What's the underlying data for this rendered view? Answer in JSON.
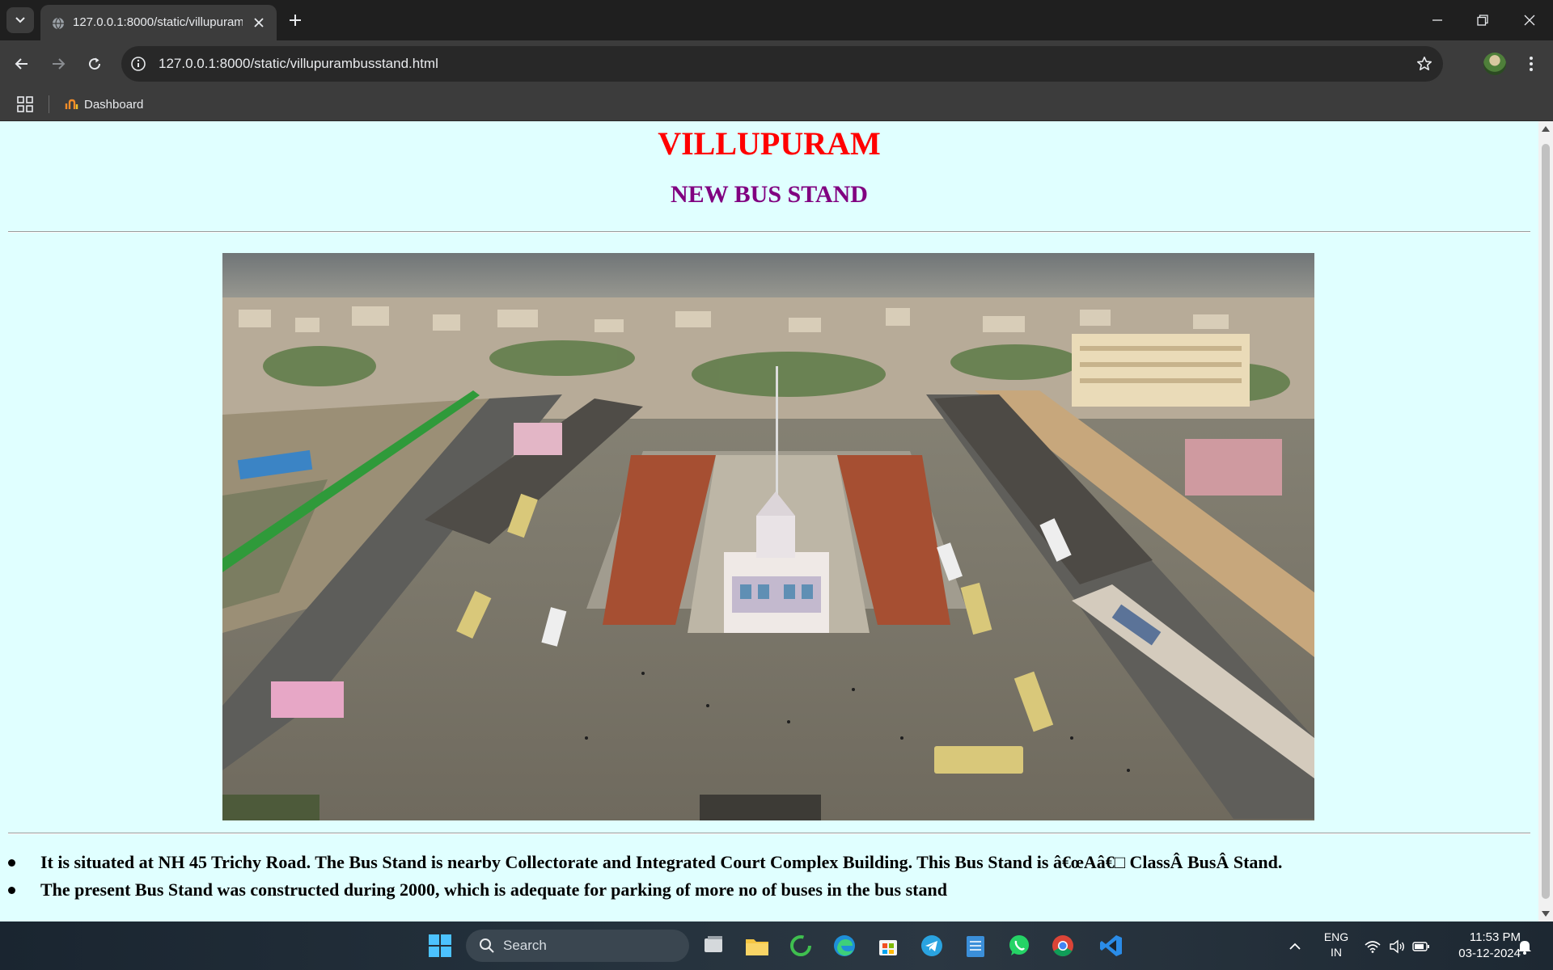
{
  "browser": {
    "tab_title": "127.0.0.1:8000/static/villupurambusstand.html",
    "url": "127.0.0.1:8000/static/villupurambusstand.html",
    "bookmark_label": "Dashboard"
  },
  "page": {
    "heading": "VILLUPURAM",
    "subheading": "NEW BUS STAND",
    "bullets": [
      "It is situated at NH 45 Trichy Road. The Bus Stand is nearby Collectorate and Integrated Court Complex Building. This Bus Stand is â€œAâ€□ ClassÂ BusÂ Stand.",
      "The present Bus Stand was constructed during 2000, which is adequate for parking of more no of buses in the bus stand"
    ],
    "colors": {
      "background": "#e0ffff",
      "heading": "#ff0000",
      "subheading": "#800080"
    }
  },
  "taskbar": {
    "search_placeholder": "Search",
    "language": "ENG",
    "region": "IN",
    "time": "11:53 PM",
    "date": "03-12-2024"
  }
}
